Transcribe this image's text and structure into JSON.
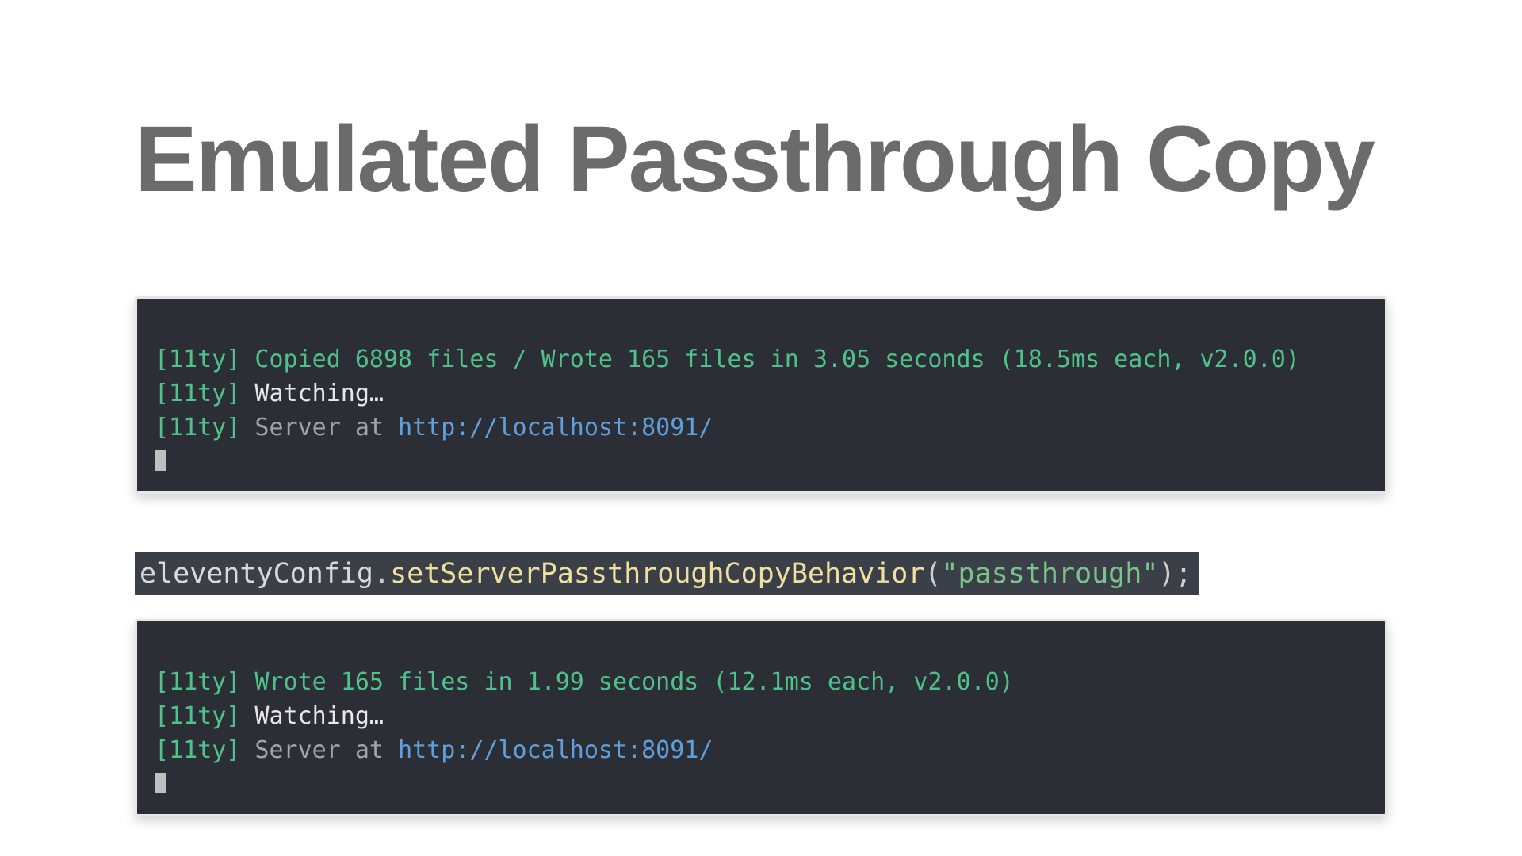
{
  "title": "Emulated Passthrough Copy",
  "terminal_before": {
    "tag": "[11ty]",
    "line1_copied": " Copied 6898 files / Wrote 165 files in 3.05 seconds (18.5ms each, v2.0.0)",
    "line2_watching": " Watching…",
    "line3_prefix": " Server at ",
    "line3_url": "http://localhost:8091/"
  },
  "code": {
    "ident": "eleventyConfig",
    "dot": ".",
    "method": "setServerPassthroughCopyBehavior",
    "open": "(",
    "string": "\"passthrough\"",
    "close": ")",
    "semi": ";"
  },
  "terminal_after": {
    "tag": "[11ty]",
    "line1_wrote": " Wrote 165 files in 1.99 seconds (12.1ms each, v2.0.0)",
    "line2_watching": " Watching…",
    "line3_prefix": " Server at ",
    "line3_url": "http://localhost:8091/"
  }
}
